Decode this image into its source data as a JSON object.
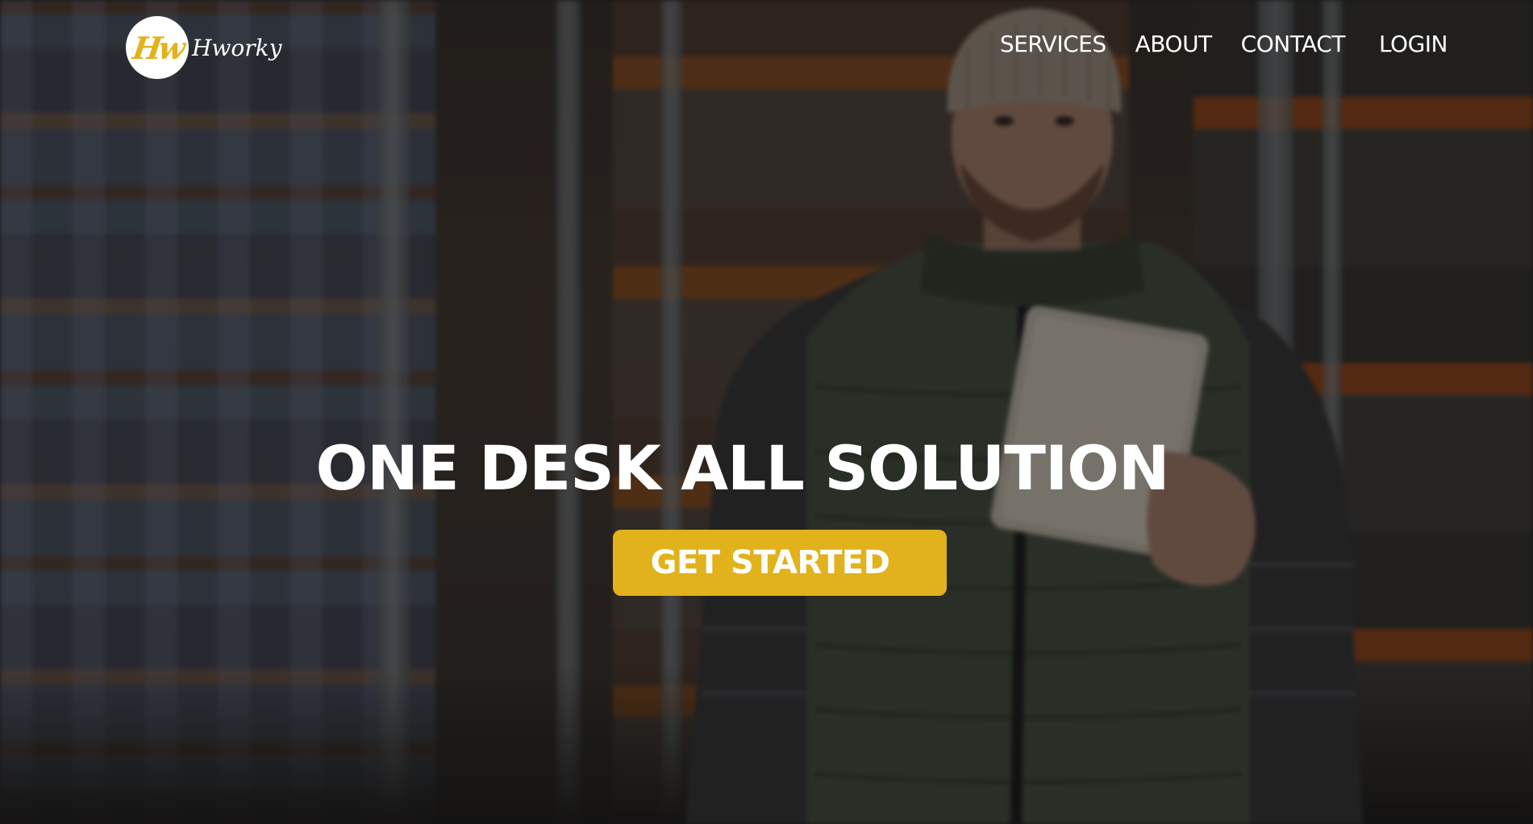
{
  "brand": {
    "logo_mark": "Hw",
    "logo_text": "Hworky",
    "accent_color": "#e1b21b"
  },
  "nav": {
    "items": [
      {
        "label": "SERVICES"
      },
      {
        "label": "ABOUT"
      },
      {
        "label": "CONTACT"
      },
      {
        "label": "LOGIN"
      }
    ]
  },
  "hero": {
    "title": "ONE DESK ALL SOLUTION",
    "cta_label": "GET STARTED"
  }
}
